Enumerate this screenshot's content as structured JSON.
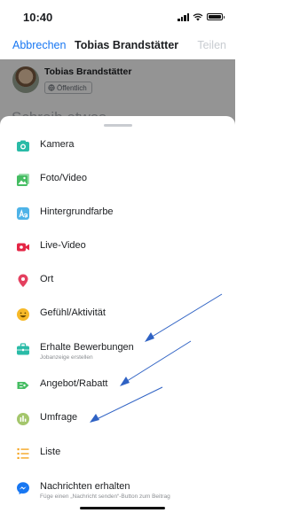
{
  "status_bar": {
    "time": "10:40"
  },
  "nav": {
    "cancel": "Abbrechen",
    "title": "Tobias Brandstätter",
    "share": "Teilen"
  },
  "composer": {
    "author": "Tobias Brandstätter",
    "privacy": "Öffentlich",
    "placeholder": "Schreib etwas..."
  },
  "menu": {
    "items": [
      {
        "label": "Kamera",
        "icon": "camera-icon",
        "color": "#2abba7"
      },
      {
        "label": "Foto/Video",
        "icon": "photo-icon",
        "color": "#45bd62"
      },
      {
        "label": "Hintergrundfarbe",
        "icon": "text-background-icon",
        "color": "#4eb3e8"
      },
      {
        "label": "Live-Video",
        "icon": "live-video-icon",
        "color": "#e42645"
      },
      {
        "label": "Ort",
        "icon": "location-pin-icon",
        "color": "#e4405f"
      },
      {
        "label": "Gefühl/Aktivität",
        "icon": "emoji-icon",
        "color": "#f7b928"
      },
      {
        "label": "Erhalte Bewerbungen",
        "sublabel": "Jobanzeige erstellen",
        "icon": "briefcase-icon",
        "color": "#2abba7"
      },
      {
        "label": "Angebot/Rabatt",
        "icon": "offer-tag-icon",
        "color": "#45bd62"
      },
      {
        "label": "Umfrage",
        "icon": "poll-icon",
        "color": "#a4c66c"
      },
      {
        "label": "Liste",
        "icon": "list-icon",
        "color": "#f5a623"
      },
      {
        "label": "Nachrichten erhalten",
        "sublabel": "Füge einen „Nachricht senden“-Button zum Beitrag",
        "icon": "messenger-icon",
        "color": "#1877f2"
      }
    ]
  },
  "annotations": {
    "arrow_color": "#2f62c4"
  }
}
